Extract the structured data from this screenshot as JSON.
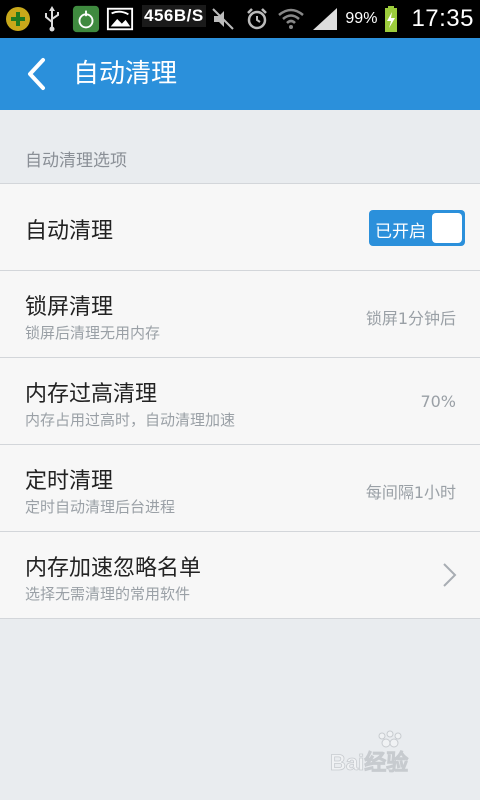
{
  "status_bar": {
    "net_speed": "456B/S",
    "battery_percent": "99%",
    "time": "17:35",
    "icons": [
      "add-circle-icon",
      "usb-icon",
      "lock-app-icon",
      "image-icon",
      "mute-icon",
      "alarm-icon",
      "wifi-icon",
      "signal-icon",
      "battery-icon"
    ]
  },
  "header": {
    "title": "自动清理",
    "back_icon": "chevron-left-icon"
  },
  "section": {
    "label": "自动清理选项"
  },
  "settings": {
    "auto_clean": {
      "title": "自动清理",
      "toggle_label": "已开启",
      "enabled": true
    },
    "lock_clean": {
      "title": "锁屏清理",
      "subtitle": "锁屏后清理无用内存",
      "value": "锁屏1分钟后"
    },
    "memory_high_clean": {
      "title": "内存过高清理",
      "subtitle": "内存占用过高时，自动清理加速",
      "value": "70%"
    },
    "timed_clean": {
      "title": "定时清理",
      "subtitle": "定时自动清理后台进程",
      "value": "每间隔1小时"
    },
    "ignore_list": {
      "title": "内存加速忽略名单",
      "subtitle": "选择无需清理的常用软件",
      "icon": "chevron-right-icon"
    }
  },
  "watermark": {
    "text": "Bai经验"
  },
  "colors": {
    "accent": "#2b90db",
    "background": "#e9ecef",
    "row_background": "#f7f7f7",
    "divider": "#d3d6da",
    "secondary_text": "#9aa0a6"
  }
}
